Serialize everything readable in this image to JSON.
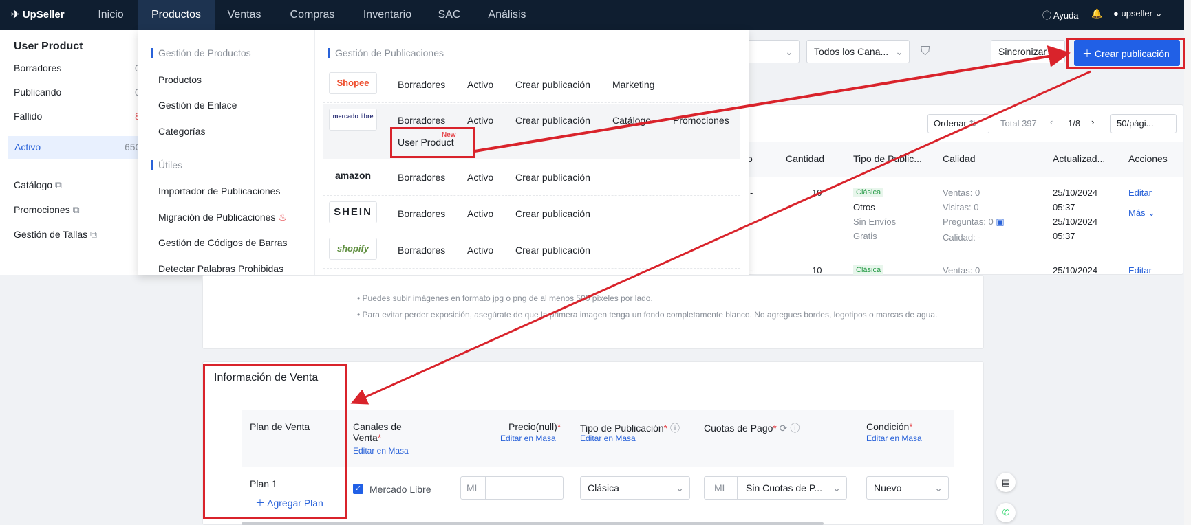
{
  "topnav": {
    "logo": "UpSeller",
    "items": [
      "Inicio",
      "Productos",
      "Ventas",
      "Compras",
      "Inventario",
      "SAC",
      "Análisis"
    ],
    "help": "Ayuda",
    "user": "upseller"
  },
  "sidebar": {
    "title": "User Product",
    "items": [
      {
        "label": "Borradores",
        "count": "0"
      },
      {
        "label": "Publicando",
        "count": "0"
      },
      {
        "label": "Fallido",
        "count": "8"
      },
      {
        "label": "Activo",
        "count": "650"
      }
    ],
    "links": [
      "Catálogo",
      "Promociones",
      "Gestión de Tallas"
    ]
  },
  "toolbar": {
    "channels_filter": "Todos los Cana...",
    "sync": "Sincronizar",
    "create": "Crear publicación",
    "sort": "Ordenar",
    "total": "Total 397",
    "page": "1/8",
    "per_page": "50/pági..."
  },
  "table": {
    "headers": [
      "o",
      "Cantidad",
      "Tipo de Public...",
      "Calidad",
      "Actualizad...",
      "Acciones"
    ],
    "row1": {
      "dash": "-",
      "qty": "10",
      "badge": "Clásica",
      "type2": "Otros",
      "ship1": "Sin Envíos",
      "ship2": "Gratis",
      "sales": "Ventas: 0",
      "visits": "Visitas: 0",
      "questions": "Preguntas: 0",
      "quality": "Calidad: -",
      "date1": "25/10/2024",
      "time1": "05:37",
      "date2": "25/10/2024",
      "time2": "05:37",
      "edit": "Editar",
      "more": "Más"
    },
    "row2": {
      "dash": "-",
      "qty": "10",
      "badge": "Clásica",
      "sales": "Ventas: 0",
      "date": "25/10/2024",
      "edit": "Editar"
    }
  },
  "menu": {
    "left_sections": [
      {
        "title": "Gestión de Productos",
        "items": [
          "Productos",
          "Gestión de Enlace",
          "Categorías"
        ]
      },
      {
        "title": "Útiles",
        "items": [
          "Importador de Publicaciones",
          "Migración de Publicaciones",
          "Gestión de Códigos de Barras",
          "Detectar Palabras Prohibidas"
        ]
      }
    ],
    "right_title": "Gestión de Publicaciones",
    "channels": [
      {
        "logo": "Shopee",
        "links": [
          "Borradores",
          "Activo",
          "Crear publicación",
          "Marketing"
        ]
      },
      {
        "logo": "mercado libre",
        "links": [
          "Borradores",
          "Activo",
          "Crear publicación",
          "Catálogo",
          "Promociones"
        ],
        "sub": "User Product",
        "badge": "New"
      },
      {
        "logo": "amazon",
        "links": [
          "Borradores",
          "Activo",
          "Crear publicación"
        ]
      },
      {
        "logo": "SHEIN",
        "links": [
          "Borradores",
          "Activo",
          "Crear publicación"
        ]
      },
      {
        "logo": "shopify",
        "links": [
          "Borradores",
          "Activo",
          "Crear publicación"
        ]
      }
    ]
  },
  "image_tips": [
    "Puedes subir imágenes en formato jpg o png de al menos 500 píxeles por lado.",
    "Para evitar perder exposición, asegúrate de que la primera imagen tenga un fondo completamente blanco. No agregues bordes, logotipos o marcas de agua."
  ],
  "sales_info": {
    "title": "Información de Venta",
    "headers": {
      "plan": "Plan de Venta",
      "channels": "Canales de Venta",
      "price": "Precio(null)",
      "pub_type": "Tipo de Publicación",
      "installments": "Cuotas de Pago",
      "condition": "Condición",
      "mass_edit": "Editar en Masa"
    },
    "row": {
      "plan": "Plan 1",
      "add_plan": "Agregar Plan",
      "channel": "Mercado Libre",
      "currency": "ML",
      "pub_type": "Clásica",
      "cuota_prefix": "ML",
      "cuota": "Sin Cuotas de P...",
      "condition": "Nuevo"
    }
  },
  "colors": {
    "accent": "#2160e6",
    "nav_bg": "#0f1e30",
    "annotation": "#d9232b"
  }
}
